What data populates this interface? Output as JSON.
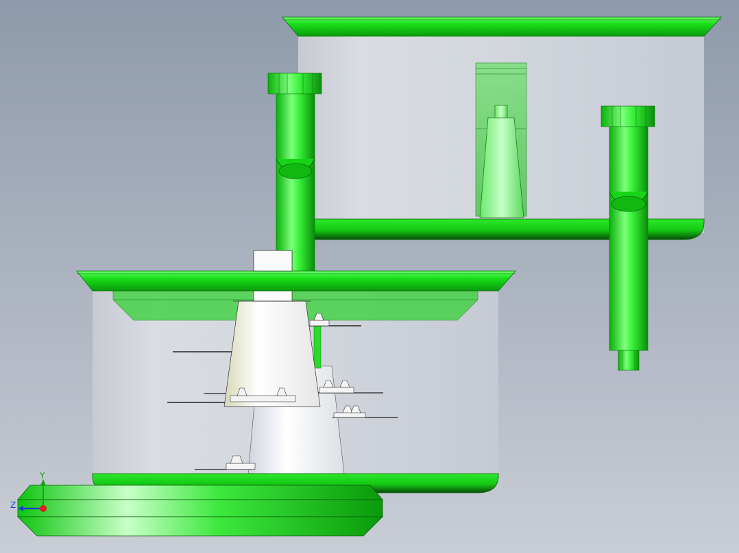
{
  "viewport": {
    "background_top": "#8e9aab",
    "background_bottom": "#c9cdd5",
    "model_color": "#1ee61e",
    "model_color_light": "#9cff9c",
    "model_color_dark": "#0a8a0a",
    "shell_color": "#cdd2da",
    "part_color": "#f2f2f2"
  },
  "triad": {
    "y_label": "Y",
    "z_label": "Z",
    "y_color": "#1aa11a",
    "z_color": "#1a3fd6",
    "origin_color": "#e02020"
  }
}
